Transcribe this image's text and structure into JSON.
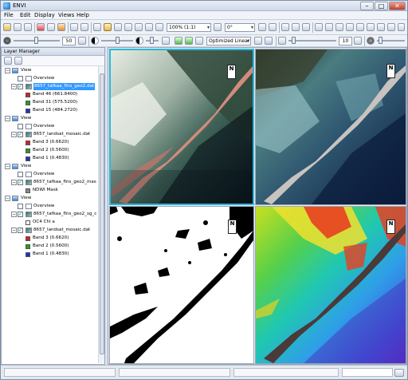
{
  "window": {
    "title": "ENVI",
    "min_label": "–",
    "max_label": "□",
    "close_label": "✕"
  },
  "menu": [
    "File",
    "Edit",
    "Display",
    "Views",
    "Help"
  ],
  "toolbar": {
    "zoom_value": "100% (1:1)",
    "rotate_value": "0°",
    "brightness_value": "50",
    "stretch_value": "Optimized Linear",
    "sharpen_value": "10"
  },
  "layer_manager": {
    "title": "Layer Manager",
    "rows": [
      {
        "kind": "view",
        "label": "View"
      },
      {
        "kind": "overview",
        "label": "Overview"
      },
      {
        "kind": "raster",
        "label": "8657_tafkaa_flns_geo2.dat",
        "selected": true
      },
      {
        "kind": "band",
        "label": "Band 46 (661.8400)",
        "color": "#d42020"
      },
      {
        "kind": "band",
        "label": "Band 31 (575.5200)",
        "color": "#20a020"
      },
      {
        "kind": "band",
        "label": "Band 15 (484.2720)",
        "color": "#2030c8"
      },
      {
        "kind": "view",
        "label": "View"
      },
      {
        "kind": "overview",
        "label": "Overview"
      },
      {
        "kind": "raster",
        "label": "8657_landsat_mosaic.dat"
      },
      {
        "kind": "band",
        "label": "Band 3 (0.6620)",
        "color": "#d42020"
      },
      {
        "kind": "band",
        "label": "Band 2 (0.5600)",
        "color": "#20a020"
      },
      {
        "kind": "band",
        "label": "Band 1 (0.4830)",
        "color": "#2030c8"
      },
      {
        "kind": "view",
        "label": "View"
      },
      {
        "kind": "overview",
        "label": "Overview"
      },
      {
        "kind": "raster",
        "label": "8657_tafkaa_flns_geo2_mas"
      },
      {
        "kind": "mask",
        "label": "NDWI Mask",
        "color": "#888888"
      },
      {
        "kind": "view",
        "label": "View"
      },
      {
        "kind": "overview",
        "label": "Overview"
      },
      {
        "kind": "raster",
        "label": "8657_tafkaa_flns_geo2_sg_c"
      },
      {
        "kind": "mask",
        "label": "OC4 Chl a",
        "color": "#ffffff"
      },
      {
        "kind": "raster",
        "label": "8657_landsat_mosaic.dat"
      },
      {
        "kind": "band",
        "label": "Band 3 (0.6620)",
        "color": "#d42020"
      },
      {
        "kind": "band",
        "label": "Band 2 (0.5600)",
        "color": "#20a020"
      },
      {
        "kind": "band",
        "label": "Band 1 (0.4830)",
        "color": "#2030c8"
      }
    ]
  },
  "views": {
    "north_label": "N"
  },
  "colors": {
    "active_view_border": "#2ab7d6",
    "selection": "#3399ff"
  }
}
